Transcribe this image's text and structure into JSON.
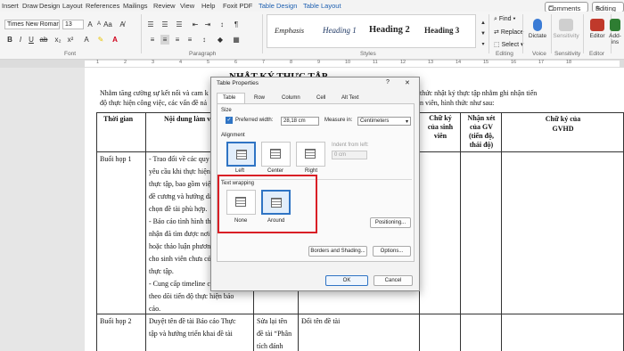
{
  "menu": {
    "items": [
      "Insert",
      "Draw",
      "Design",
      "Layout",
      "References",
      "Mailings",
      "Review",
      "View",
      "Help",
      "Foxit PDF",
      "Table Design",
      "Table Layout"
    ],
    "comments": "Comments",
    "editing": "Editing"
  },
  "ribbon": {
    "font_name": "Times New Roman",
    "font_size": "13",
    "find": "Find",
    "replace": "Replace",
    "select": "Select",
    "dictate": "Dictate",
    "sensitivity": "Sensitivity",
    "editor": "Editor",
    "addins": "Add-ins",
    "styles": [
      "Emphasis",
      "Heading 1",
      "Heading 2",
      "Heading 3"
    ],
    "groups": {
      "font": "Font",
      "paragraph": "Paragraph",
      "styles": "Styles",
      "editing": "Editing",
      "voice": "Voice",
      "sensitivity": "Sensitivity",
      "editor": "Editor",
      "addins": "Add-ins"
    }
  },
  "ruler": [
    "1",
    "2",
    "3",
    "4",
    "5",
    "6",
    "7",
    "8",
    "9",
    "10",
    "11",
    "12",
    "13",
    "14",
    "15",
    "16",
    "17",
    "18"
  ],
  "document": {
    "title": "NHẬT KÝ THỰC TẬP",
    "intro_line1": "Nhằm tăng cường sự kết nối và cam k",
    "intro_line1_right": "thức nhật ký thực tập nhằm ghi nhận tiến",
    "intro_line2": "độ thực hiện công việc, các vấn đề nả",
    "intro_line2_right": "n viên, hình thức như sau:",
    "headers": {
      "time": "Thời gian",
      "content": "Nội dung làm v",
      "sv_sign": [
        "Chữ ký",
        "của sinh",
        "viên"
      ],
      "gv_comment": [
        "Nhận xét",
        "của GV",
        "(tiến độ,",
        "thái độ)"
      ],
      "gvhd_sign": [
        "Chữ ký của",
        "GVHD"
      ]
    },
    "row1_time": "Buổi họp 1",
    "row1_lines": [
      "- Trao đổi về các quy đ",
      "yêu cầu khi thực hiện b",
      "thực tập, bao gồm việc",
      "đề cương và hướng dẫ",
      "chọn đề tài phù hợp.",
      "- Báo cáo tình hình thự",
      "nhận đã tìm được nơi t",
      "hoặc thảo luận phương",
      "cho sinh viên chưa có d",
      "thực tập.",
      "- Cung cấp timeline ch",
      "theo dõi tiến độ thực hiện báo",
      "cáo."
    ],
    "row2_time": "Buổi họp 2",
    "row2_content": [
      "Duyệt  tên đề tài Báo cáo Thực",
      "tập và hướng triển khai đề tài"
    ],
    "row2_col3": [
      "Sửa lại tên",
      "đề tài “Phân",
      "tích đánh"
    ],
    "row2_col4": "Đổi tên đề tài"
  },
  "dialog": {
    "title": "Table Properties",
    "help": "?",
    "close": "✕",
    "tabs": [
      "Table",
      "Row",
      "Column",
      "Cell",
      "Alt Text"
    ],
    "size_label": "Size",
    "preferred_width_label": "Preferred width:",
    "preferred_width_value": "28,18 cm",
    "measure_in_label": "Measure in:",
    "measure_in_value": "Centimeters",
    "alignment_label": "Alignment",
    "align_options": [
      "Left",
      "Center",
      "Right"
    ],
    "indent_label": "Indent from left:",
    "indent_value": "0 cm",
    "wrapping_label": "Text wrapping",
    "wrap_options": [
      "None",
      "Around"
    ],
    "positioning_button": "Positioning...",
    "borders_button": "Borders and Shading...",
    "options_button": "Options...",
    "ok_button": "OK",
    "cancel_button": "Cancel"
  },
  "colors": {
    "accent": "#2f74c4",
    "highlight": "#d91f26",
    "context_tab": "#1d5fb0"
  }
}
